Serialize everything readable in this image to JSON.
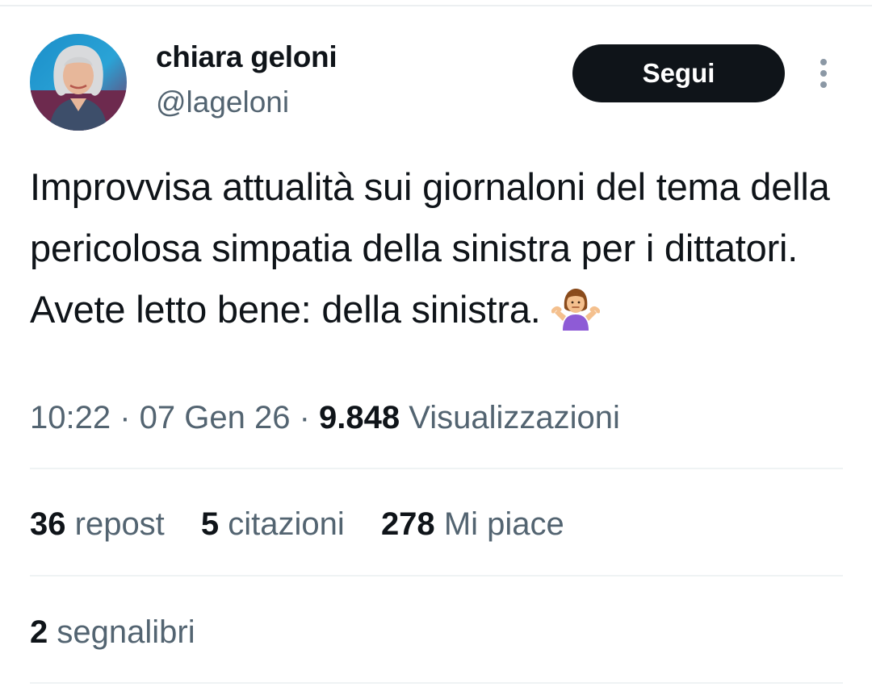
{
  "author": {
    "display_name": "chiara geloni",
    "handle": "@lageloni"
  },
  "follow_button": {
    "label": "Segui"
  },
  "tweet": {
    "text": "Improvvisa attualità sui giornaloni del tema della pericolosa simpatia della sinistra per i dittatori. Avete letto bene: della sinistra.",
    "emoji_icon": "person-shrugging-icon"
  },
  "meta": {
    "time": "10:22",
    "separator": " · ",
    "date": "07 Gen 26",
    "views_count": "9.848",
    "views_label": "Visualizzazioni"
  },
  "stats": {
    "reposts": {
      "count": "36",
      "label": "repost"
    },
    "quotes": {
      "count": "5",
      "label": "citazioni"
    },
    "likes": {
      "count": "278",
      "label": "Mi piace"
    }
  },
  "bookmarks": {
    "count": "2",
    "label": "segnalibri"
  },
  "colors": {
    "text_primary": "#0f1419",
    "text_secondary": "#536471",
    "button_bg": "#0f1419",
    "divider": "#eff3f4"
  }
}
